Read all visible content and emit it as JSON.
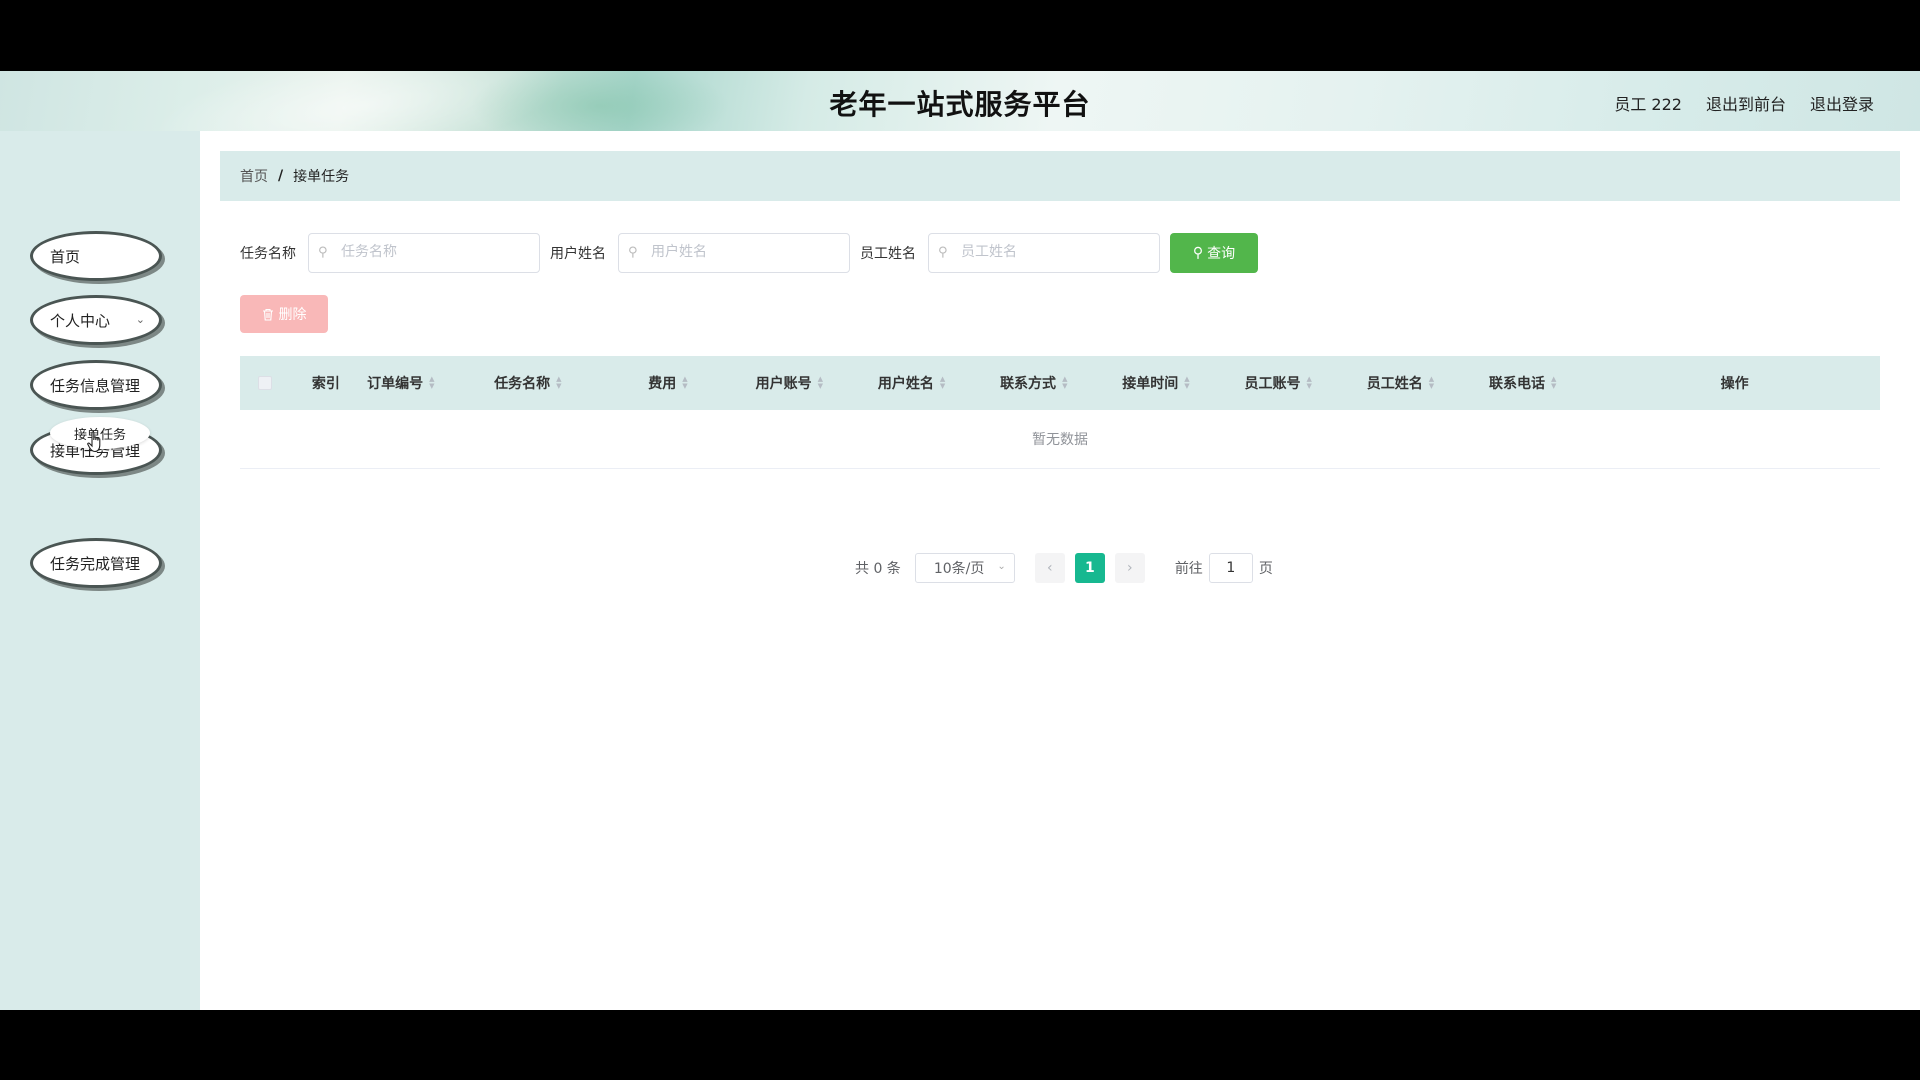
{
  "header": {
    "title": "老年一站式服务平台",
    "user": "员工 222",
    "to_front": "退出到前台",
    "logout": "退出登录"
  },
  "sidebar": {
    "items": [
      {
        "label": "首页"
      },
      {
        "label": "个人中心"
      },
      {
        "label": "任务信息管理"
      },
      {
        "label": "接单任务管理"
      },
      {
        "label": "任务完成管理"
      }
    ],
    "sub_item": "接单任务"
  },
  "breadcrumb": {
    "home": "首页",
    "separator": "/",
    "current": "接单任务"
  },
  "search": {
    "task_name_label": "任务名称",
    "task_name_placeholder": "任务名称",
    "user_name_label": "用户姓名",
    "user_name_placeholder": "用户姓名",
    "staff_name_label": "员工姓名",
    "staff_name_placeholder": "员工姓名",
    "query_button": "查询"
  },
  "actions": {
    "delete_button": "删除"
  },
  "table": {
    "columns": [
      "索引",
      "订单编号",
      "任务名称",
      "费用",
      "用户账号",
      "用户姓名",
      "联系方式",
      "接单时间",
      "员工账号",
      "员工姓名",
      "联系电话",
      "操作"
    ],
    "empty_text": "暂无数据"
  },
  "pagination": {
    "total_text": "共 0 条",
    "page_size": "10条/页",
    "current_page": "1",
    "goto_label": "前往",
    "goto_value": "1",
    "page_suffix": "页"
  },
  "colors": {
    "accent": "#17b890",
    "query_button": "#52b64b",
    "delete_button": "#f9b8b8",
    "panel": "#d9ebea"
  }
}
